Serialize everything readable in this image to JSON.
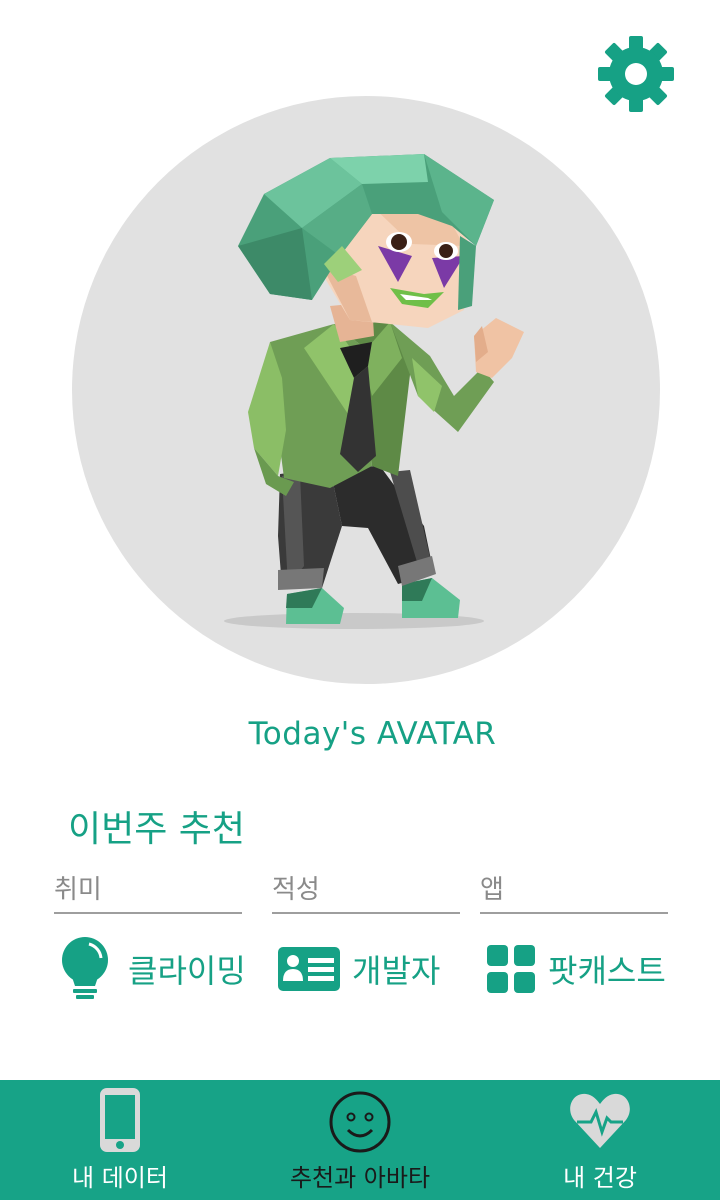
{
  "colors": {
    "accent": "#16a185",
    "nav_background": "#17a387",
    "avatar_bg": "#e1e1e1",
    "active_label": "#1a1a1a"
  },
  "avatar": {
    "caption": "Today's AVATAR"
  },
  "recommend": {
    "title": "이번주 추천",
    "columns": [
      {
        "category": "취미",
        "item": "클라이밍",
        "icon": "lightbulb-icon"
      },
      {
        "category": "적성",
        "item": "개발자",
        "icon": "id-card-icon"
      },
      {
        "category": "앱",
        "item": "팟캐스트",
        "icon": "apps-grid-icon"
      }
    ]
  },
  "nav": {
    "tabs": [
      {
        "label": "내 데이터",
        "icon": "smartphone-icon",
        "active": false
      },
      {
        "label": "추천과 아바타",
        "icon": "smiley-icon",
        "active": true
      },
      {
        "label": "내 건강",
        "icon": "heart-pulse-icon",
        "active": false
      }
    ]
  },
  "header": {
    "settings_icon": "gear-icon"
  }
}
